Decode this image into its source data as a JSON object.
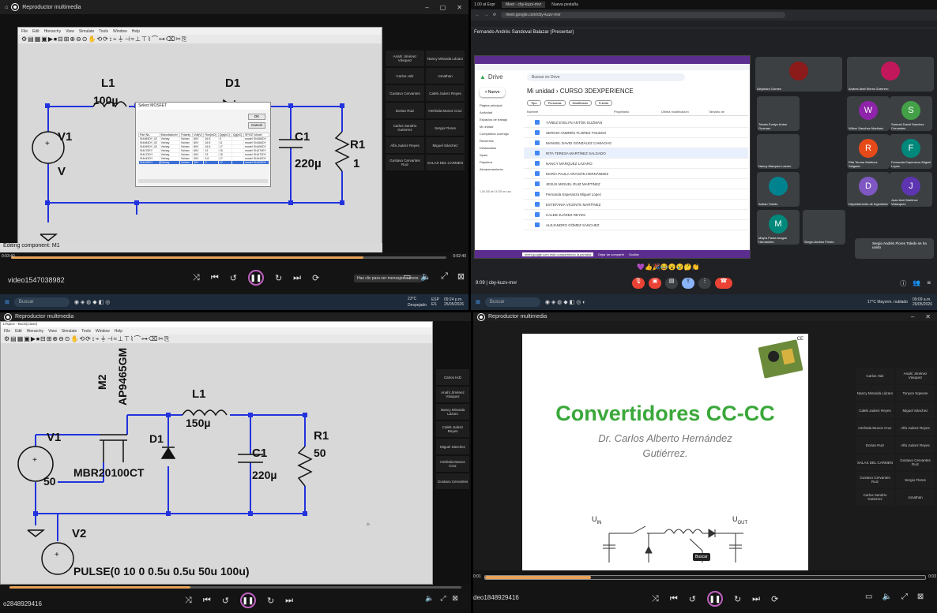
{
  "q1": {
    "window_title": "Reproductor multimedia",
    "lt_title": "LTspice - Draft5",
    "menu": [
      "File",
      "Edit",
      "Hierarchy",
      "View",
      "Simulate",
      "Tools",
      "Window",
      "Help"
    ],
    "labels": {
      "L1": "L1",
      "L1v": "100µ",
      "D1": "D1",
      "V1": "V1",
      "V1v": "V",
      "C1": "C1",
      "C1v": "220µ",
      "R1": "R1",
      "R1v": "1"
    },
    "dialog": {
      "title": "Select MOSFET",
      "ok": "OK",
      "cancel": "Cancel",
      "headers": [
        "Part No.",
        "Manufacturer",
        "Polarity",
        "Vds[V]",
        "Ron[mΩ]",
        "Qgs[nC]",
        "Qg[nC]",
        "SPICE Model"
      ],
      "rows": [
        [
          "Si4480DY_02",
          "Vishay",
          "Nchan",
          "80V",
          "16.5",
          "9",
          "",
          "model Si4480DY"
        ],
        [
          "Si4484DY_02",
          "Vishay",
          "Nchan",
          "80V",
          "16.5",
          "11",
          "",
          "model Si4484DY"
        ],
        [
          "Si4490DY_02",
          "Vishay",
          "Nchan",
          "80V",
          "16.5",
          "17",
          "",
          "model Si4490DY"
        ],
        [
          "SI4470EY",
          "Vishay",
          "Nchan",
          "60V",
          "13",
          "15",
          "",
          "model SI4470EY"
        ],
        [
          "SI4472DY",
          "Vishay",
          "Nchan",
          "60V",
          "13",
          "15",
          "",
          "model SI4472DY"
        ],
        [
          "SI4442DY",
          "Vishay",
          "Nchan",
          "30V",
          "3.6",
          "17",
          "",
          "model SI4442DY"
        ],
        [
          "SI4420DY",
          "Vishay",
          "Nchan",
          "30V",
          "9",
          "12",
          "",
          "model SI4420DY"
        ]
      ]
    },
    "status": "Editing component: M1",
    "time_left": "0:03:40",
    "time_right": "0:02:40",
    "filename": "video1547038982",
    "tooltip": "Haz clic para ver mensajes nuevos",
    "participants": [
      "Anahí Jiménez Vásquez",
      "Nancy Miranda Lázaro",
      "Carlos Hdz",
      "Jonathan",
      "Gustavo Cervantes",
      "Caleb Juárez Reyes",
      "Dorian Ruiz",
      "Herlinda Munoz Cruz",
      "Carlos Sandrio Gutierrez",
      "Sergio Flores",
      "Alfa Juárez Reyes",
      "Miguel Sánchez",
      "Gustavo Cervantes Ruiz",
      "SALAS DEL CARMEN"
    ],
    "taskbar": {
      "search": "Buscar",
      "weather": "23°C",
      "weather_sub": "Despejado",
      "lang": "ESP",
      "lang2": "ES",
      "time": "09:24 p.m.",
      "date": "25/05/2026"
    }
  },
  "q2": {
    "tabs": [
      "1.00 at Espr",
      "Meet - cby-kuzv-mvr",
      "Nueva pestaña"
    ],
    "url": "meet.google.com/cby-kuzv-mvr",
    "presenter": "Fernando Andrés Sandoval Balazar (Presentar)",
    "drive": {
      "logo": "Drive",
      "search": "Buscar en Drive",
      "new": "+ Nuevo",
      "path_root": "Mi unidad",
      "path_folder": "CURSO 3DEXPERIENCE",
      "filters": [
        "Tipo",
        "Personas",
        "Modificado",
        "Fuente"
      ],
      "columns": [
        "Nombre",
        "Propietario",
        "Última modificación",
        "Tamaño de"
      ],
      "nav": [
        "Página principal",
        "Actividad",
        "Espacios de trabajo",
        "Mi unidad",
        "Compartido conmigo",
        "Recientes",
        "Destacados",
        "Spam",
        "Papelera",
        "Almacenamiento"
      ],
      "storage": "1,06 GB de 15 GB en uso",
      "files": [
        "YÁÑEZ EVELYN ANTÓN GUZMÁN",
        "SERGIO ANDRÉS FLORES TOLEDO",
        "MANUEL DAVID GONZÁLEZ CAMACHO",
        "RITA TERESA MARTÍNEZ SALGADO",
        "NANCY MÁRQUEZ LÁZARO",
        "MARÍA PAULA ARAGÓN HERNÁNDEZ",
        "JESÚS MIGUEL RUIZ MARTÍNEZ",
        "Fernanda Esperanza Miguel López",
        "ESTEFANIA VICENTE MARTÍNEZ",
        "CALEB JUÁREZ REYES",
        "ALEJANDRO GÓMEZ SÁNCHEZ"
      ]
    },
    "share_banner": "meet.google.com está compartiendo la pantalla",
    "share_stop": "Dejar de compartir",
    "share_hide": "Ocultar",
    "tiles": [
      {
        "name": "Alejandro Gomez",
        "letter": "",
        "color": "#8b1a1a"
      },
      {
        "name": "Andres Abel Sierra Guerrero",
        "letter": "",
        "color": "#c2185b"
      },
      {
        "name": "Tobalo Evelyn Anton Guzman",
        "letter": "",
        "color": "#3c4043"
      },
      {
        "name": "Wilver Sanchez Martinez",
        "letter": "W",
        "color": "#8e24aa"
      },
      {
        "name": "Samuel David Sanchez Cervantes",
        "letter": "S",
        "color": "#43a047"
      },
      {
        "name": "Nancy Marquez Lazaro",
        "letter": "",
        "color": "#3c4043"
      },
      {
        "name": "Rita Teresa Martinez Salgado",
        "letter": "R",
        "color": "#e64a19"
      },
      {
        "name": "Fernanda Esperanza Miguel Lopez",
        "letter": "F",
        "color": "#00897b"
      },
      {
        "name": "Adrian Toledo",
        "letter": "",
        "color": "#00838f"
      },
      {
        "name": "Departamento de Ingenieria",
        "letter": "D",
        "color": "#7e57c2"
      },
      {
        "name": "Juan Axel Martinez Velazquez",
        "letter": "J",
        "color": "#5e35b1"
      },
      {
        "name": "Mayra Paola Aragon Hernandez",
        "letter": "M",
        "color": "#00897b"
      },
      {
        "name": "Sergio Andres Flores",
        "letter": "",
        "color": "#3c4043"
      }
    ],
    "toast": "Sergio Andrés Flores Toledo se ha unido",
    "meeting_time": "9:09",
    "meeting_code": "cby-kuzv-mvr",
    "taskbar": {
      "search": "Buscar",
      "weather": "17°C",
      "weather_sub": "Mayorm. nublado",
      "time": "09:09 a.m.",
      "date": "26/05/2026"
    }
  },
  "q3": {
    "window_title": "Reproductor multimedia",
    "lt_title": "LTspice - Buck(Clase)",
    "menu": [
      "File",
      "Edit",
      "Hierarchy",
      "View",
      "Simulate",
      "Tools",
      "Window",
      "Help"
    ],
    "labels": {
      "M2": "M2",
      "AP": "AP9465GM",
      "L1": "L1",
      "L1v": "150µ",
      "D1": "D1",
      "Dmodel": "MBR20100CT",
      "V1": "V1",
      "V1v": "50",
      "C1": "C1",
      "C1v": "220µ",
      "R1": "R1",
      "R1v": "50",
      "V2": "V2",
      "pulse": "PULSE(0 10 0 0.5u 0.5u 50u 100u)"
    },
    "filename": "o2848929416",
    "participants": [
      "Carlos Hdz",
      "Anahí Jiménez Vásquez",
      "Nancy Miranda Lázaro",
      "Caleb Juárez Reyes",
      "Miguel Sánchez",
      "Herlinda Munoz Cruz",
      "Gustavo Cervantes"
    ]
  },
  "q4": {
    "window_title": "Reproductor multimedia",
    "slide_title": "Convertidores CC-CC",
    "slide_author_1": "Dr. Carlos Alberto Hernández",
    "slide_author_2": "Gutiérrez.",
    "ce_mark": "CE",
    "u_in": "U",
    "u_in_sub": "IN",
    "u_out": "U",
    "u_out_sub": "OUT",
    "tooltip": "Buscar",
    "time_left": "0:01",
    "time_right": "0:03",
    "filename": "deo1848929416",
    "participants": [
      "Carlos Hdz",
      "Anahí Jiménez Vásquez",
      "Nancy Miranda Lázaro",
      "Tonyon Sqwone",
      "Caleb Juárez Reyes",
      "Miguel Sánchez",
      "Herlinda Munoz Cruz",
      "Alfa Juárez Reyes",
      "Dorian Ruiz",
      "Alfa Juárez Reyes",
      "SALAS DEL CARMEN",
      "Gustavo Cervantes Ruiz",
      "Gustavo Cervantes Ruiz",
      "Sergio Flores",
      "Carlos Sandrio Gutierrez",
      "Jonathan"
    ]
  },
  "colors": {
    "accent": "#e8a35a",
    "wire": "#2233dd",
    "green_title": "#3aa83a",
    "meet_bg": "#202124"
  }
}
